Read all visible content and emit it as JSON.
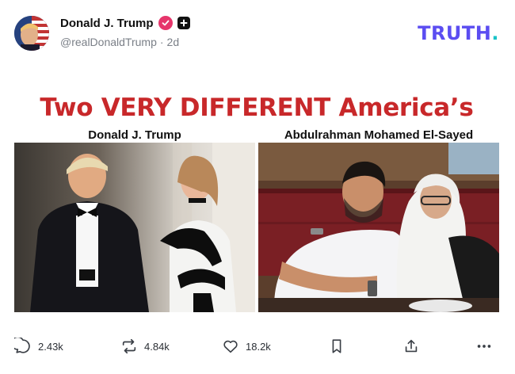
{
  "post": {
    "author_name": "Donald J. Trump",
    "handle": "@realDonaldTrump",
    "separator": "·",
    "time": "2d"
  },
  "brand": {
    "text": "TRUTH",
    "dot": ".",
    "color": "#5b4df1",
    "dot_color": "#19c3c8"
  },
  "media": {
    "headline": "Two VERY DIFFERENT America’s",
    "headline_color": "#c8282a",
    "left_caption": "Donald J. Trump",
    "right_caption": "Abdulrahman Mohamed El-Sayed"
  },
  "actions": {
    "replies": "2.43k",
    "retruths": "4.84k",
    "likes": "18.2k"
  },
  "icons": [
    "verified-icon",
    "plus-badge-icon",
    "reply-icon",
    "retruth-icon",
    "like-icon",
    "bookmark-icon",
    "share-icon",
    "more-icon"
  ],
  "colors": {
    "verified": "#e6356b",
    "meta_text": "#7a7f87"
  }
}
